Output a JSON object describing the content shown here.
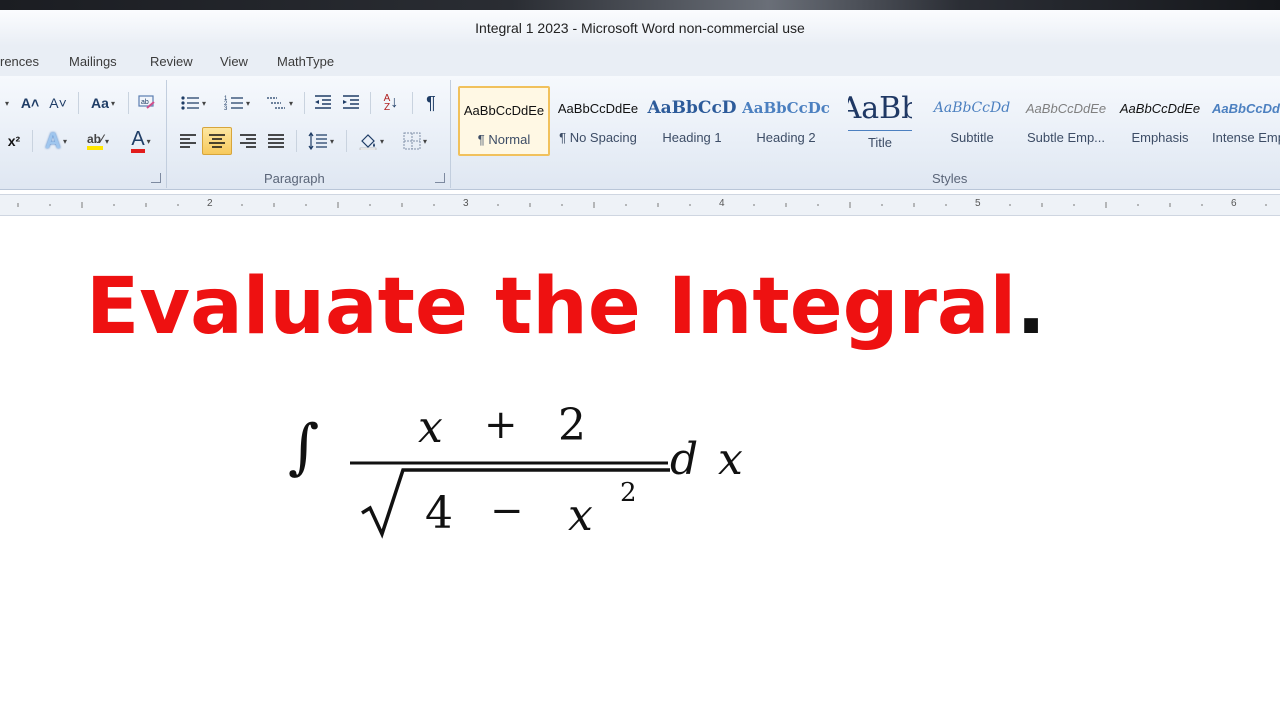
{
  "window": {
    "title": "Integral 1 2023  -  Microsoft Word non-commercial use"
  },
  "tabs": [
    "rences",
    "Mailings",
    "Review",
    "View",
    "MathType"
  ],
  "ribbon": {
    "groups": {
      "paragraph": "Paragraph",
      "styles": "Styles"
    },
    "font_buttons": {
      "grow_font": "A˄",
      "shrink_font": "A˅",
      "change_case": "Aa",
      "superscript": "x²",
      "text_effects": "A",
      "highlight": "ab⁄",
      "font_color": "A"
    },
    "paragraph_buttons": {
      "sort": "↓",
      "show_marks": "¶"
    },
    "styles": [
      {
        "preview": "AaBbCcDdEe",
        "name": "¶ Normal"
      },
      {
        "preview": "AaBbCcDdEe",
        "name": "¶ No Spacing"
      },
      {
        "preview": "AaBbCcD",
        "name": "Heading 1"
      },
      {
        "preview": "AaBbCcDc",
        "name": "Heading 2"
      },
      {
        "preview": "AaBb",
        "name": "Title"
      },
      {
        "preview": "AaBbCcDd",
        "name": "Subtitle"
      },
      {
        "preview": "AaBbCcDdEe",
        "name": "Subtle Emp..."
      },
      {
        "preview": "AaBbCcDdEe",
        "name": "Emphasis"
      },
      {
        "preview": "AaBbCcDd",
        "name": "Intense Emp"
      }
    ]
  },
  "ruler": {
    "numbers": [
      "2",
      "3",
      "4",
      "5",
      "6"
    ]
  },
  "document": {
    "headline": "Evaluate the Integral",
    "headline_period": ".",
    "equation": {
      "integral": "∫",
      "numerator": [
        "x",
        "+",
        "2"
      ],
      "denominator": [
        "4",
        "−",
        "x"
      ],
      "exponent": "2",
      "differential": [
        "d",
        "x"
      ]
    }
  },
  "colors": {
    "headline": "#ee1111",
    "selected_button": "#f7c95c"
  }
}
